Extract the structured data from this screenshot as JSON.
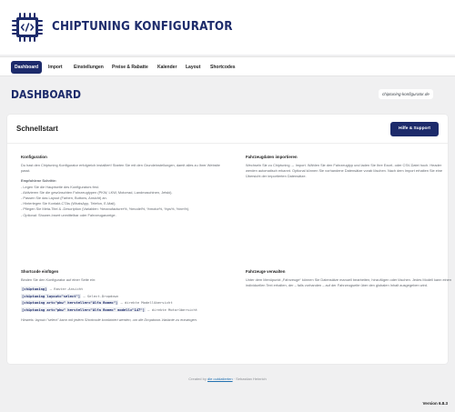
{
  "header": {
    "title": "CHIPTUNING KONFIGURATOR",
    "logo_icon": "chip-code-icon"
  },
  "nav": {
    "items": [
      "Dashboard",
      "Import",
      "Einstellungen",
      "Preise & Rabatte",
      "Kalender",
      "Layout",
      "Shortcodes"
    ],
    "active": 0
  },
  "page": {
    "title": "DASHBOARD",
    "site": "chiptuning-konfigurator.de"
  },
  "card": {
    "title": "Schnellstart",
    "help_button": "Hilfe & Support",
    "konfiguration": {
      "heading": "Konfiguration",
      "intro": "Du hast den Chiptuning Konfigurator erfolgreich installiert! Starten Sie mit den Grundeinstellungen, damit alles zu Ihrer Website passt.",
      "steps_heading": "Empfohlene Schritte:",
      "steps": [
        "- Legen Sie die Hauptseite des Konfigurators fest.",
        "- Aktivieren Sie die gewünschten Fahrzeugtypen (PKW, LKW, Motorrad, Landmaschinen, Jetski).",
        "- Passen Sie das Layout (Farben, Buttons, Ansicht) an.",
        "- Hinterlegen Sie Kontakt-CTAs (WhatsApp, Telefon, E-Mail).",
        "- Pflegen Sie Meta-Titel & -Description (Variablen: %manufacturer%, %model%, %motor%, %ps%, %nm%).",
        "- Optional: Shower-Insert unmittelbar oder Fahrzeuganzeige."
      ]
    },
    "fahrzeugdaten": {
      "heading": "Fahrzeugdaten importieren",
      "text": "Wechseln Sie zu Chiptuning → Import. Wählen Sie den Fahrzeugtyp und laden Sie Ihre Excel- oder CSV-Datei hoch. Header werden automatisch erkannt. Optional können Sie vorhandene Datensätze vorab löschen. Nach dem Import erhalten Sie eine Übersicht der importierten Datensätze."
    },
    "shortcode": {
      "heading": "Shortcode einfügen",
      "intro": "Binden Sie den Konfigurator auf einer Seite ein:",
      "lines": [
        {
          "code": "[chiptuning]",
          "desc": "– Raster-Ansicht"
        },
        {
          "code": "[chiptuning layout=\"select\"]",
          "desc": "– Select-Dropdown"
        },
        {
          "code": "[chiptuning art=\"pkw\" hersteller=\"Alfa Romeo\"]",
          "desc": "– direkte Modellübersicht"
        },
        {
          "code": "[chiptuning art=\"pkw\" hersteller=\"Alfa Romeo\" modell=\"147\"]",
          "desc": "– direkte Motorübersicht"
        }
      ],
      "hint": "Hinweis: layout=\"select\" kann mit jedem Shortcode kombiniert werden, um die Dropdown-Variante zu erzwingen."
    },
    "fahrzeuge": {
      "heading": "Fahrzeuge verwalten",
      "text": "Unter dem Menüpunkt „Fahrzeuge“ können Sie Datensätze manuell bearbeiten, hinzufügen oder löschen. Jedes Modell kann einen individuellen Text erhalten, der – falls vorhanden – auf der Fahrzeugseite über den globalen Inhalt ausgegeben wird."
    }
  },
  "footer": {
    "prefix": "Created by",
    "link": "die outdatierten",
    "suffix": " · Sebastian Heinrich"
  },
  "version": "Version 6.8.3",
  "colors": {
    "primary": "#1d2b6b",
    "background": "#f0f0f1"
  }
}
